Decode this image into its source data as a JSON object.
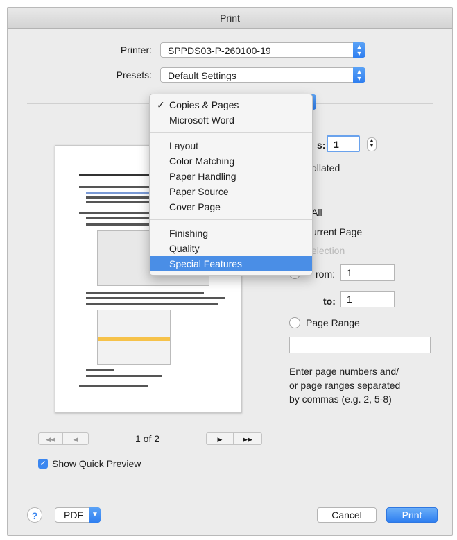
{
  "window": {
    "title": "Print"
  },
  "printer": {
    "label": "Printer:",
    "value": "SPPDS03-P-260100-19"
  },
  "presets": {
    "label": "Presets:",
    "value": "Default Settings"
  },
  "menu": {
    "group1": [
      {
        "label": "Copies & Pages",
        "checked": true
      },
      {
        "label": "Microsoft Word"
      }
    ],
    "group2": [
      {
        "label": "Layout"
      },
      {
        "label": "Color Matching"
      },
      {
        "label": "Paper Handling"
      },
      {
        "label": "Paper Source"
      },
      {
        "label": "Cover Page"
      }
    ],
    "group3": [
      {
        "label": "Finishing"
      },
      {
        "label": "Quality"
      },
      {
        "label": "Special Features",
        "selected": true
      }
    ]
  },
  "copies": {
    "label_fragment": "s:",
    "value": "1",
    "collated_fragment": "ollated"
  },
  "pages": {
    "label_fragment": ":",
    "all_fragment": "All",
    "current_fragment": "urrent Page",
    "selection_fragment": "election",
    "from_fragment": "rom:",
    "from_value": "1",
    "to_label": "to:",
    "to_value": "1",
    "range_label": "Page Range",
    "range_value": "",
    "hint_lines": [
      "Enter page numbers and/",
      "or page ranges separated",
      "by commas (e.g. 2, 5-8)"
    ]
  },
  "navigation": {
    "page_indicator": "1 of 2",
    "first": "◀◀",
    "prev": "◀",
    "next": "▶",
    "last": "▶▶"
  },
  "quick_preview": {
    "label": "Show Quick Preview",
    "checked": true
  },
  "footer": {
    "help": "?",
    "pdf": "PDF",
    "cancel": "Cancel",
    "print": "Print"
  },
  "colors": {
    "accent": "#4a8ee6",
    "button_blue": "#3a86f0"
  }
}
